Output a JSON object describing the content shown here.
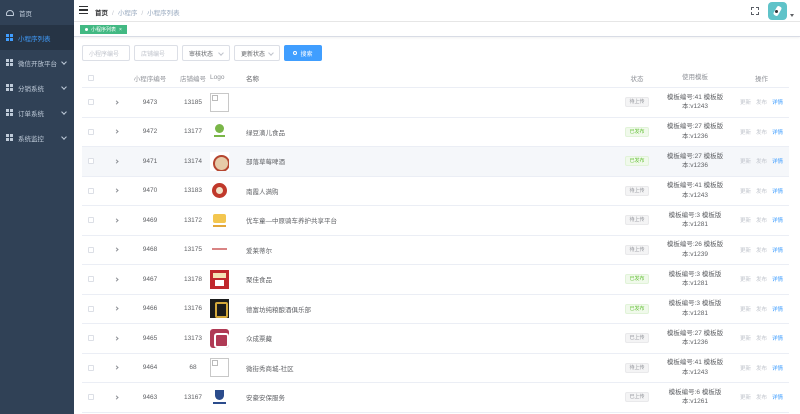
{
  "sidebar": {
    "items": [
      {
        "label": "首页",
        "icon": "dashboard-icon",
        "active": false,
        "has_children": false
      },
      {
        "label": "小程序列表",
        "icon": "grid-icon",
        "active": true,
        "has_children": false
      },
      {
        "label": "微信开放平台",
        "icon": "grid-icon",
        "active": false,
        "has_children": true
      },
      {
        "label": "分销系统",
        "icon": "grid-icon",
        "active": false,
        "has_children": true
      },
      {
        "label": "订单系统",
        "icon": "grid-icon",
        "active": false,
        "has_children": true
      },
      {
        "label": "系统监控",
        "icon": "grid-icon",
        "active": false,
        "has_children": true
      }
    ]
  },
  "navbar": {
    "breadcrumb": [
      "首页",
      "小程序",
      "小程序列表"
    ]
  },
  "tags": {
    "active_tag": "小程序列表",
    "close": "×",
    "color": "#42b983"
  },
  "filters": {
    "miniapp_id_placeholder": "小程序编号",
    "store_id_placeholder": "店铺编号",
    "audit_status": "审核状态",
    "update_status": "更新状态",
    "search_label": "搜索"
  },
  "table": {
    "headers": {
      "miniapp_id": "小程序编号",
      "store_id": "店铺编号",
      "logo": "Logo",
      "name": "名称",
      "status": "状态",
      "template": "使用模板",
      "ops": "操作"
    },
    "op_labels": {
      "update": "更新",
      "publish": "发布",
      "detail": "详情"
    },
    "rows": [
      {
        "miniapp_id": "9473",
        "store_id": "13185",
        "logo": "broken-image",
        "name": "",
        "status": "待上传",
        "template_line1": "模板编号:41 模板版",
        "template_line2": "本:v1243"
      },
      {
        "miniapp_id": "9472",
        "store_id": "13177",
        "logo": "green-leaf-logo",
        "name": "绿豆滴儿食品",
        "status": "已发布",
        "template_line1": "模板编号:27 模板版",
        "template_line2": "本:v1236"
      },
      {
        "miniapp_id": "9471",
        "store_id": "13174",
        "logo": "cake-logo",
        "name": "部落草莓啤酒",
        "status": "已发布",
        "template_line1": "模板编号:27 模板版",
        "template_line2": "本:v1236"
      },
      {
        "miniapp_id": "9470",
        "store_id": "13183",
        "logo": "red-circle-logo",
        "name": "南霞人满购",
        "status": "待上传",
        "template_line1": "模板编号:41 模板版",
        "template_line2": "本:v1243"
      },
      {
        "miniapp_id": "9469",
        "store_id": "13172",
        "logo": "car-logo",
        "name": "优车童—中原骑车养护共享平台",
        "status": "待上传",
        "template_line1": "模板编号:3 模板版",
        "template_line2": "本:v1281"
      },
      {
        "miniapp_id": "9468",
        "store_id": "13175",
        "logo": "text-logo",
        "name": "爱莱蒂尔",
        "status": "待上传",
        "template_line1": "模板编号:26 模板版",
        "template_line2": "本:v1239"
      },
      {
        "miniapp_id": "9467",
        "store_id": "13178",
        "logo": "shop-logo",
        "name": "聚佳食品",
        "status": "已发布",
        "template_line1": "模板编号:3 模板版",
        "template_line2": "本:v1281"
      },
      {
        "miniapp_id": "9466",
        "store_id": "13176",
        "logo": "dark-logo",
        "name": "德富坊纯粮酿酒俱乐部",
        "status": "已发布",
        "template_line1": "模板编号:3 模板版",
        "template_line2": "本:v1281"
      },
      {
        "miniapp_id": "9465",
        "store_id": "13173",
        "logo": "pink-logo",
        "name": "众成票藏",
        "status": "已上传",
        "template_line1": "模板编号:27 模板版",
        "template_line2": "本:v1236"
      },
      {
        "miniapp_id": "9464",
        "store_id": "68",
        "logo": "broken-image",
        "name": "微街秀商城-社区",
        "status": "待上传",
        "template_line1": "模板编号:41 模板版",
        "template_line2": "本:v1243"
      },
      {
        "miniapp_id": "9463",
        "store_id": "13167",
        "logo": "shield-logo",
        "name": "安豪安保服务",
        "status": "已上传",
        "template_line1": "模板编号:6 模板版",
        "template_line2": "本:v1261"
      }
    ]
  },
  "colors": {
    "sidebar_bg": "#304156",
    "accent": "#409eff",
    "published": "#67c23a"
  }
}
